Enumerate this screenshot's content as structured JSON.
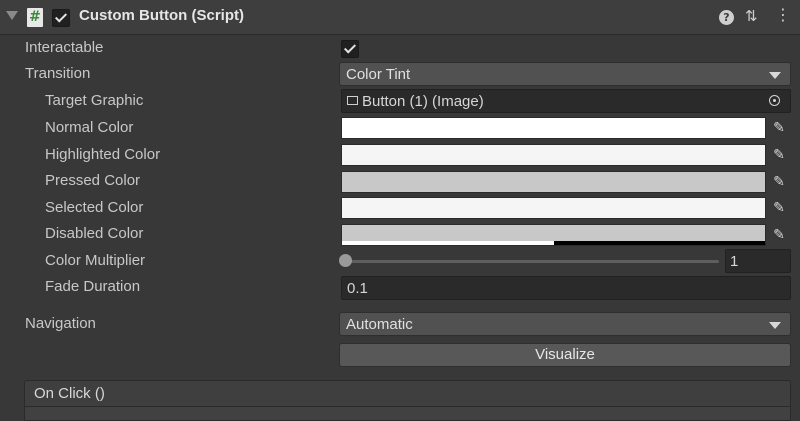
{
  "header": {
    "title": "Custom Button (Script)",
    "script_icon": "#",
    "icons": [
      "script-icon",
      "help-icon",
      "preset-icon",
      "context-menu-icon"
    ]
  },
  "fields": {
    "interactable": {
      "label": "Interactable",
      "checked": true
    },
    "transition": {
      "label": "Transition",
      "value": "Color Tint"
    },
    "target_graphic": {
      "label": "Target Graphic",
      "value": "Button (1) (Image)"
    },
    "normal_color": {
      "label": "Normal Color",
      "color": "#ffffff"
    },
    "highlighted_color": {
      "label": "Highlighted Color",
      "color": "#f5f5f5"
    },
    "pressed_color": {
      "label": "Pressed Color",
      "color": "#c8c8c8"
    },
    "selected_color": {
      "label": "Selected Color",
      "color": "#f5f5f5"
    },
    "disabled_color": {
      "label": "Disabled Color",
      "color": "#c8c8c8",
      "alpha": 0.5
    },
    "color_multiplier": {
      "label": "Color Multiplier",
      "value": "1"
    },
    "fade_duration": {
      "label": "Fade Duration",
      "value": "0.1"
    },
    "navigation": {
      "label": "Navigation",
      "value": "Automatic"
    }
  },
  "visualize_label": "Visualize",
  "on_click": {
    "label": "On Click ()"
  }
}
